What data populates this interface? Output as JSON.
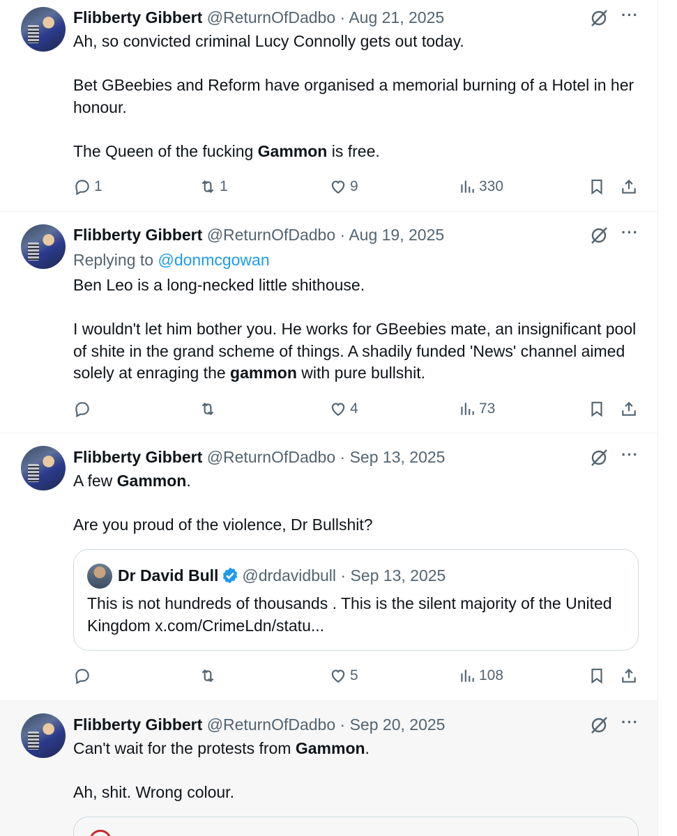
{
  "tweets": [
    {
      "name": "Flibberty Gibbert",
      "handle": "@ReturnOfDadbo",
      "date": "Aug 21, 2025",
      "paragraphs": [
        [
          {
            "t": "Ah, so convicted criminal Lucy Connolly gets out today."
          }
        ],
        [
          {
            "t": "Bet GBeebies and Reform have organised a memorial burning of a Hotel in her honour."
          }
        ],
        [
          {
            "t": "The Queen of the fucking "
          },
          {
            "t": "Gammon",
            "b": true
          },
          {
            "t": " is free."
          }
        ]
      ],
      "stats": {
        "replies": "1",
        "reposts": "1",
        "likes": "9",
        "views": "330"
      }
    },
    {
      "name": "Flibberty Gibbert",
      "handle": "@ReturnOfDadbo",
      "date": "Aug 19, 2025",
      "replying_prefix": "Replying to ",
      "replying_to": "@donmcgowan",
      "paragraphs": [
        [
          {
            "t": "Ben Leo is a long-necked little shithouse."
          }
        ],
        [
          {
            "t": "I wouldn't let him bother you. He works for GBeebies mate, an insignificant pool of shite in the grand scheme of things. A shadily funded 'News' channel aimed solely at enraging the "
          },
          {
            "t": "gammon",
            "b": true
          },
          {
            "t": " with pure bullshit."
          }
        ]
      ],
      "stats": {
        "replies": "",
        "reposts": "",
        "likes": "4",
        "views": "73"
      }
    },
    {
      "name": "Flibberty Gibbert",
      "handle": "@ReturnOfDadbo",
      "date": "Sep 13, 2025",
      "paragraphs": [
        [
          {
            "t": "A few "
          },
          {
            "t": "Gammon",
            "b": true
          },
          {
            "t": "."
          }
        ],
        [
          {
            "t": "Are you proud of the violence, Dr Bullshit?"
          }
        ]
      ],
      "quote": {
        "name": "Dr David Bull",
        "handle": "@drdavidbull",
        "date": "Sep 13, 2025",
        "text": "This is not hundreds of thousands . This is the silent majority of the United Kingdom x.com/CrimeLdn/statu..."
      },
      "stats": {
        "replies": "",
        "reposts": "",
        "likes": "5",
        "views": "108"
      }
    },
    {
      "name": "Flibberty Gibbert",
      "handle": "@ReturnOfDadbo",
      "date": "Sep 20, 2025",
      "paragraphs": [
        [
          {
            "t": "Can't wait for the protests from "
          },
          {
            "t": "Gammon",
            "b": true
          },
          {
            "t": "."
          }
        ],
        [
          {
            "t": "Ah, shit. Wrong colour."
          }
        ]
      ]
    }
  ],
  "separator": " · ",
  "more_glyph": "···",
  "colors": {
    "secondary": "#536471",
    "link": "#1d9bf0",
    "verified": "#1d9bf0",
    "border": "#eff3f4"
  }
}
